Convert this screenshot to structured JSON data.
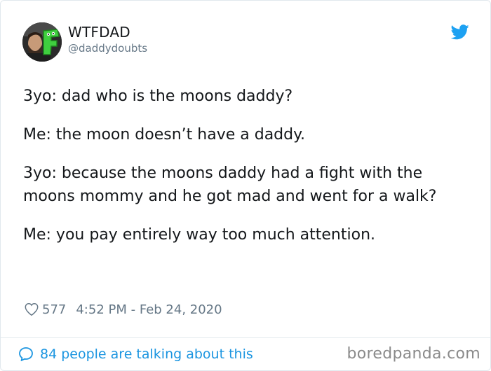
{
  "author": {
    "display_name": "WTFDAD",
    "handle": "@daddydoubts",
    "avatar_icon": "profile-photo-man-with-green-f-icon"
  },
  "tweet": {
    "paragraphs": [
      "3yo: dad who is the moons daddy?",
      "Me: the moon doesn’t have a daddy.",
      "3yo: because the moons daddy had a fight with the moons mommy and he got mad and went for a walk?",
      "Me: you pay entirely way too much attention."
    ]
  },
  "meta": {
    "like_count": "577",
    "timestamp": "4:52 PM - Feb 24, 2020"
  },
  "footer": {
    "talking_text": "84 people are talking about this",
    "watermark": "boredpanda.com"
  },
  "colors": {
    "twitter_blue": "#1da1f2",
    "link_blue": "#1b95e0",
    "text": "#14171a",
    "muted": "#657786"
  }
}
